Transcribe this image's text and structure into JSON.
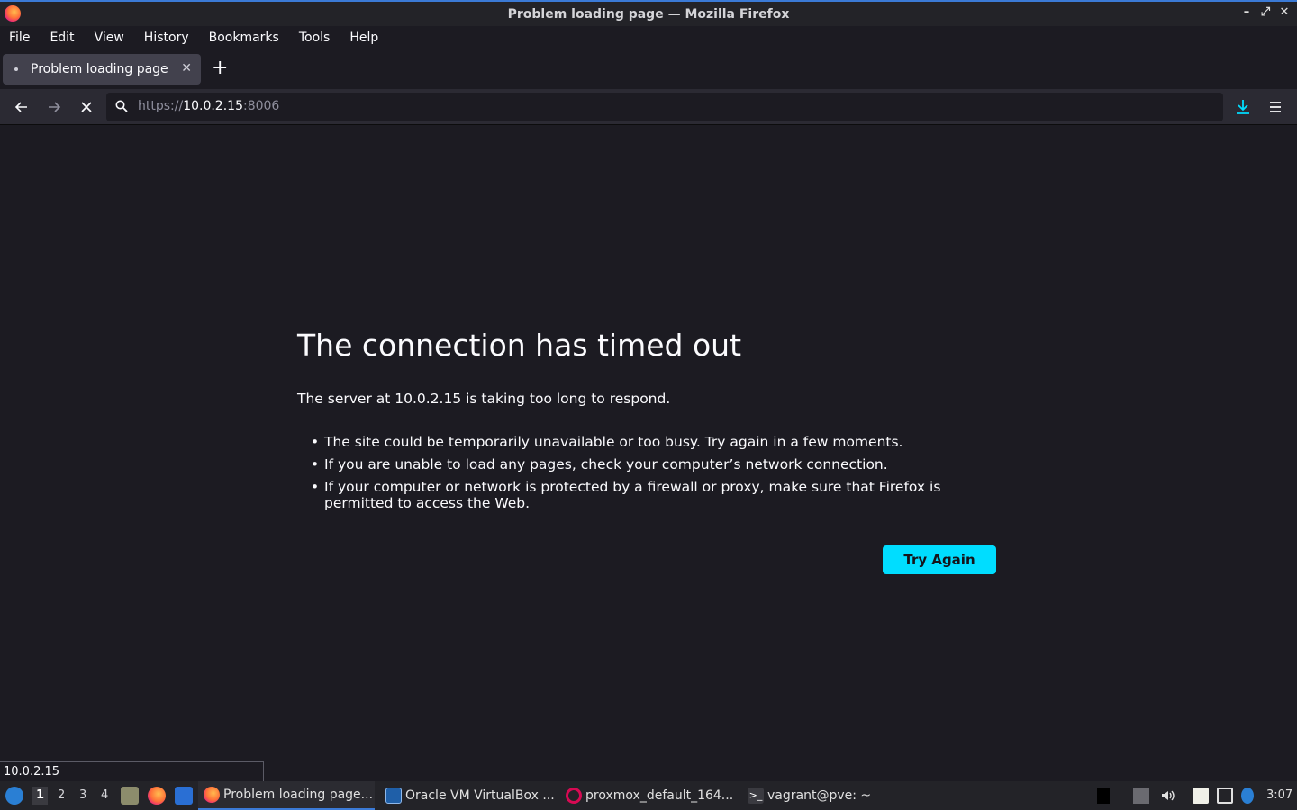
{
  "window": {
    "title": "Problem loading page — Mozilla Firefox"
  },
  "menu": {
    "file": "File",
    "edit": "Edit",
    "view": "View",
    "history": "History",
    "bookmarks": "Bookmarks",
    "tools": "Tools",
    "help": "Help"
  },
  "tabs": [
    {
      "label": "Problem loading page",
      "active": true
    }
  ],
  "navbar": {
    "url_scheme": "https://",
    "url_host": "10.0.2.15",
    "url_port": ":8006"
  },
  "error": {
    "title": "The connection has timed out",
    "description": "The server at 10.0.2.15 is taking too long to respond.",
    "suggestions": [
      "The site could be temporarily unavailable or too busy. Try again in a few moments.",
      "If you are unable to load any pages, check your computer’s network connection.",
      "If your computer or network is protected by a firewall or proxy, make sure that Firefox is permitted to access the Web."
    ],
    "try_again_label": "Try Again"
  },
  "status": {
    "text": "10.0.2.15"
  },
  "taskbar": {
    "workspaces": [
      "1",
      "2",
      "3",
      "4"
    ],
    "active_workspace": "1",
    "tasks": [
      {
        "label": "Problem loading page...",
        "icon": "firefox-icon",
        "active": true
      },
      {
        "label": "Oracle VM VirtualBox ...",
        "icon": "virtualbox-icon",
        "active": false
      },
      {
        "label": "proxmox_default_164...",
        "icon": "debian-icon",
        "active": false
      },
      {
        "label": "vagrant@pve: ~",
        "icon": "terminal-icon",
        "active": false
      }
    ],
    "clock": "3:07"
  },
  "colors": {
    "accent": "#00ddff",
    "background": "#1c1b22",
    "toolbar": "#2b2a33",
    "tab_active": "#42414d"
  }
}
